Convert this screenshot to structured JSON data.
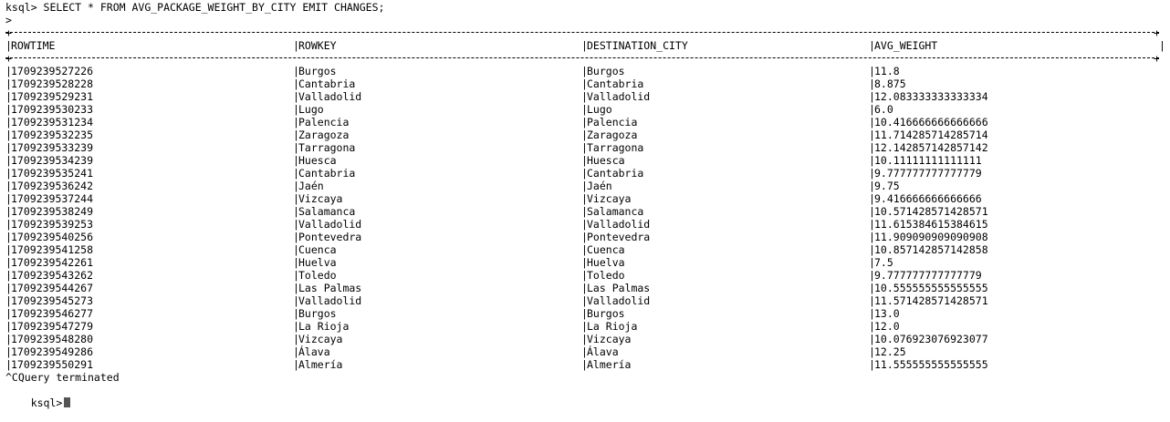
{
  "prompt_line": "ksql> SELECT * FROM AVG_PACKAGE_WEIGHT_BY_CITY EMIT CHANGES;",
  "continuation": ">",
  "columns": [
    "ROWTIME",
    "ROWKEY",
    "DESTINATION_CITY",
    "AVG_WEIGHT"
  ],
  "rows": [
    [
      "1709239527226",
      "Burgos",
      "Burgos",
      "11.8"
    ],
    [
      "1709239528228",
      "Cantabria",
      "Cantabria",
      "8.875"
    ],
    [
      "1709239529231",
      "Valladolid",
      "Valladolid",
      "12.083333333333334"
    ],
    [
      "1709239530233",
      "Lugo",
      "Lugo",
      "6.0"
    ],
    [
      "1709239531234",
      "Palencia",
      "Palencia",
      "10.416666666666666"
    ],
    [
      "1709239532235",
      "Zaragoza",
      "Zaragoza",
      "11.714285714285714"
    ],
    [
      "1709239533239",
      "Tarragona",
      "Tarragona",
      "12.142857142857142"
    ],
    [
      "1709239534239",
      "Huesca",
      "Huesca",
      "10.11111111111111"
    ],
    [
      "1709239535241",
      "Cantabria",
      "Cantabria",
      "9.777777777777779"
    ],
    [
      "1709239536242",
      "Jaén",
      "Jaén",
      "9.75"
    ],
    [
      "1709239537244",
      "Vizcaya",
      "Vizcaya",
      "9.416666666666666"
    ],
    [
      "1709239538249",
      "Salamanca",
      "Salamanca",
      "10.571428571428571"
    ],
    [
      "1709239539253",
      "Valladolid",
      "Valladolid",
      "11.615384615384615"
    ],
    [
      "1709239540256",
      "Pontevedra",
      "Pontevedra",
      "11.909090909090908"
    ],
    [
      "1709239541258",
      "Cuenca",
      "Cuenca",
      "10.857142857142858"
    ],
    [
      "1709239542261",
      "Huelva",
      "Huelva",
      "7.5"
    ],
    [
      "1709239543262",
      "Toledo",
      "Toledo",
      "9.777777777777779"
    ],
    [
      "1709239544267",
      "Las Palmas",
      "Las Palmas",
      "10.555555555555555"
    ],
    [
      "1709239545273",
      "Valladolid",
      "Valladolid",
      "11.571428571428571"
    ],
    [
      "1709239546277",
      "Burgos",
      "Burgos",
      "13.0"
    ],
    [
      "1709239547279",
      "La Rioja",
      "La Rioja",
      "12.0"
    ],
    [
      "1709239548280",
      "Vizcaya",
      "Vizcaya",
      "10.076923076923077"
    ],
    [
      "1709239549286",
      "Álava",
      "Álava",
      "12.25"
    ],
    [
      "1709239550291",
      "Almería",
      "Almería",
      "11.555555555555555"
    ]
  ],
  "terminated_message": "^CQuery terminated",
  "final_prompt": "ksql>",
  "colors": {
    "background": "#ffffff",
    "text": "#000000",
    "cursor": "#555555"
  }
}
